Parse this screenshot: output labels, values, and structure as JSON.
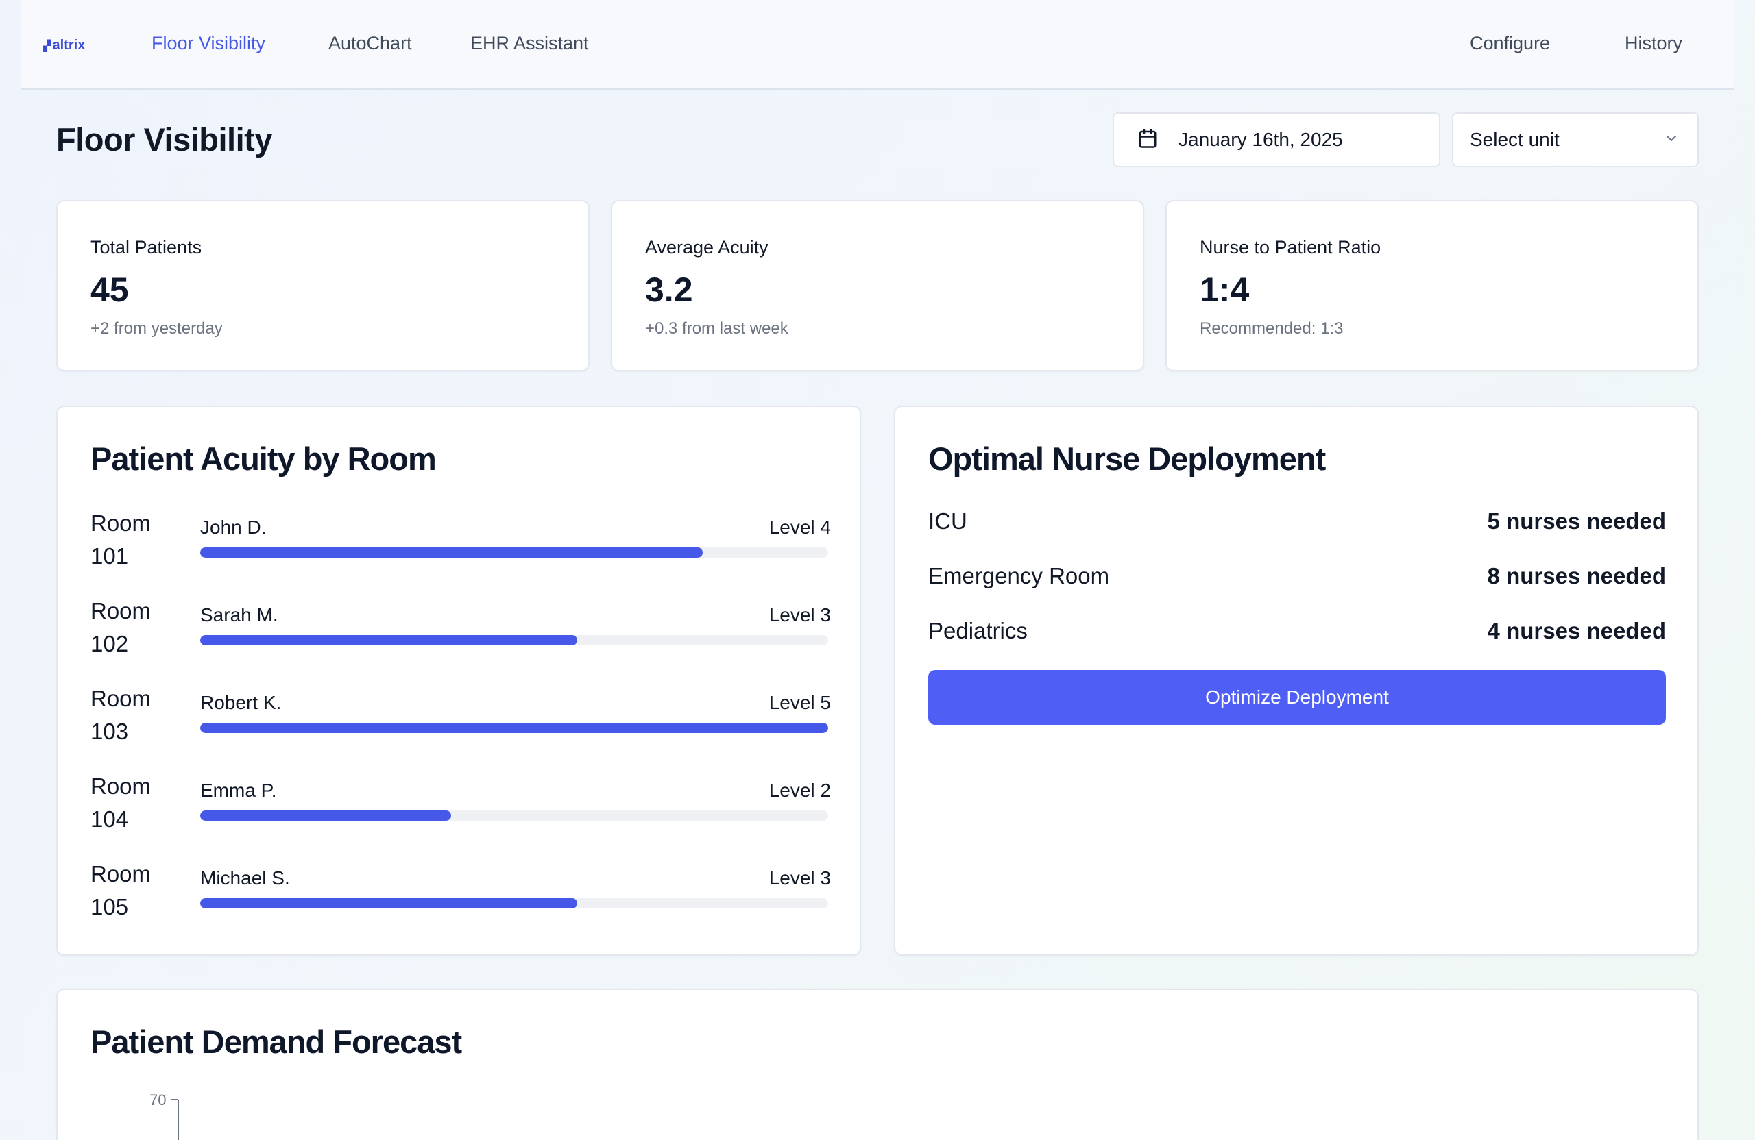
{
  "nav": {
    "logo": "altrix",
    "links": [
      "Floor Visibility",
      "AutoChart",
      "EHR Assistant"
    ],
    "active": "Floor Visibility",
    "right_links": [
      "Configure",
      "History"
    ]
  },
  "header": {
    "title": "Floor Visibility",
    "date": "January 16th, 2025",
    "unit_select": "Select unit"
  },
  "stats": [
    {
      "label": "Total Patients",
      "value": "45",
      "sub": "+2 from yesterday"
    },
    {
      "label": "Average Acuity",
      "value": "3.2",
      "sub": "+0.3 from last week"
    },
    {
      "label": "Nurse to Patient Ratio",
      "value": "1:4",
      "sub": "Recommended: 1:3"
    }
  ],
  "acuity": {
    "title": "Patient Acuity by Room",
    "rooms": [
      {
        "room_line1": "Room",
        "room_line2": "101",
        "patient": "John D.",
        "level_label": "Level 4",
        "level": 4
      },
      {
        "room_line1": "Room",
        "room_line2": "102",
        "patient": "Sarah M.",
        "level_label": "Level 3",
        "level": 3
      },
      {
        "room_line1": "Room",
        "room_line2": "103",
        "patient": "Robert K.",
        "level_label": "Level 5",
        "level": 5
      },
      {
        "room_line1": "Room",
        "room_line2": "104",
        "patient": "Emma P.",
        "level_label": "Level 2",
        "level": 2
      },
      {
        "room_line1": "Room",
        "room_line2": "105",
        "patient": "Michael S.",
        "level_label": "Level 3",
        "level": 3
      }
    ],
    "max_level": 5
  },
  "deployment": {
    "title": "Optimal Nurse Deployment",
    "units": [
      {
        "name": "ICU",
        "need": "5 nurses needed"
      },
      {
        "name": "Emergency Room",
        "need": "8 nurses needed"
      },
      {
        "name": "Pediatrics",
        "need": "4 nurses needed"
      }
    ],
    "button": "Optimize Deployment"
  },
  "forecast": {
    "title": "Patient Demand Forecast",
    "y_tick_top": "70"
  },
  "colors": {
    "accent": "#4558e8",
    "button": "#4f5ff6",
    "track": "#eef0f3"
  }
}
